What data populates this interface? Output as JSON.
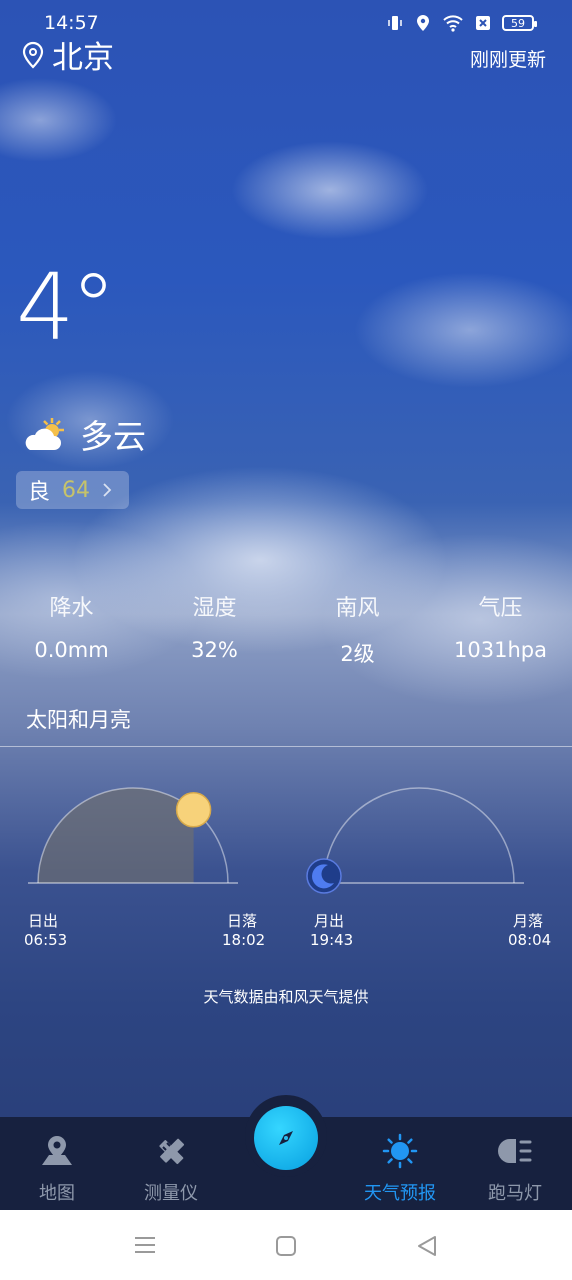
{
  "status_bar": {
    "time": "14:57",
    "battery": "59"
  },
  "header": {
    "city": "北京",
    "update_text": "刚刚更新"
  },
  "current": {
    "temperature": "4°",
    "condition": "多云",
    "aqi_label": "良",
    "aqi_value": "64"
  },
  "stats": [
    {
      "label": "降水",
      "value": "0.0mm"
    },
    {
      "label": "湿度",
      "value": "32%"
    },
    {
      "label": "南风",
      "value": "2级"
    },
    {
      "label": "气压",
      "value": "1031hpa"
    }
  ],
  "sun_moon": {
    "title": "太阳和月亮",
    "sunrise_label": "日出",
    "sunrise_time": "06:53",
    "sunset_label": "日落",
    "sunset_time": "18:02",
    "moonrise_label": "月出",
    "moonrise_time": "19:43",
    "moonset_label": "月落",
    "moonset_time": "08:04",
    "sun_progress": 0.72,
    "moon_progress": 0.0
  },
  "credit": "天气数据由和风天气提供",
  "nav": {
    "items": [
      {
        "label": "地图",
        "icon": "map-icon"
      },
      {
        "label": "测量仪",
        "icon": "ruler-pencil-icon"
      },
      {
        "label": "",
        "icon": "compass-icon"
      },
      {
        "label": "天气预报",
        "icon": "sun-icon"
      },
      {
        "label": "跑马灯",
        "icon": "marquee-light-icon"
      }
    ],
    "active_color": "#2196f3"
  },
  "colors": {
    "sun": "#f7d27a",
    "moon": "#4f7cf0",
    "nav_bg": "#17213f"
  }
}
